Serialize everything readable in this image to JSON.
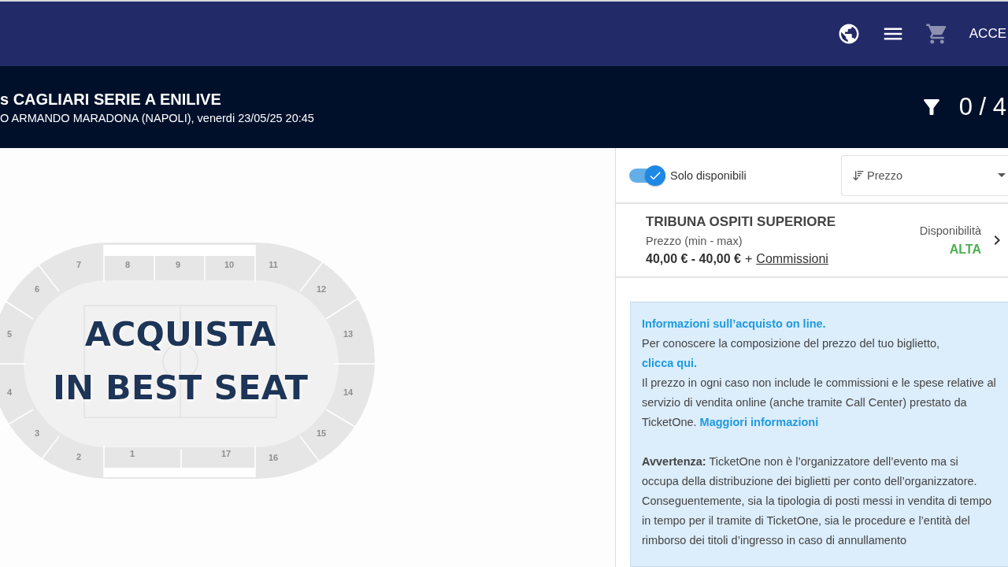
{
  "nav": {
    "account_label": "ACCE"
  },
  "event": {
    "title": "s CAGLIARI SERIE A ENILIVE",
    "subtitle": "O ARMANDO MARADONA (NAPOLI), venerdi 23/05/25 20:45",
    "ticket_count": "0 / 4"
  },
  "map": {
    "sections": [
      {
        "label": "7"
      },
      {
        "label": "8"
      },
      {
        "label": "9"
      },
      {
        "label": "10"
      },
      {
        "label": "11"
      },
      {
        "label": "6"
      },
      {
        "label": "12"
      },
      {
        "label": "5"
      },
      {
        "label": "13"
      },
      {
        "label": "4"
      },
      {
        "label": "14"
      },
      {
        "label": "3"
      },
      {
        "label": "15"
      },
      {
        "label": "2"
      },
      {
        "label": "1"
      },
      {
        "label": "17"
      },
      {
        "label": "16"
      }
    ],
    "banner": [
      "ACQUISTA",
      "IN BEST SEAT"
    ]
  },
  "filters": {
    "only_available": {
      "label": "Solo disponibili",
      "on": true
    },
    "sort": {
      "value": "Prezzo"
    }
  },
  "sectors": [
    {
      "name": "TRIBUNA OSPITI SUPERIORE",
      "price_label": "Prezzo (min - max)",
      "price": "40,00 € - 40,00 €",
      "plus": "+",
      "fees_link": "Commissioni",
      "availability_label": "Disponibilità",
      "availability": "ALTA"
    }
  ],
  "info": {
    "title": "Informazioni sull’acquisto on line.",
    "paragraphs": [
      {
        "text": "Per conoscere la composizione del prezzo del tuo biglietto,",
        "link": "clicca qui."
      },
      {
        "text": "Il prezzo in ogni caso non include le commissioni e le spese relative al servizio di vendita online (anche tramite Call Center) prestato da TicketOne.",
        "link": "Maggiori informazioni"
      }
    ],
    "warning": "**Avvertenza:** TicketOne non è l’organizzatore dell’evento ma si occupa della distribuzione dei biglietti per conto dell’organizzatore. Conseguentemente, sia la tipologia di posti messi in vendita di tempo in tempo per il tramite di TicketOne, sia le procedure e l’entità del rimborso dei titoli d’ingresso in caso di annullamento"
  }
}
